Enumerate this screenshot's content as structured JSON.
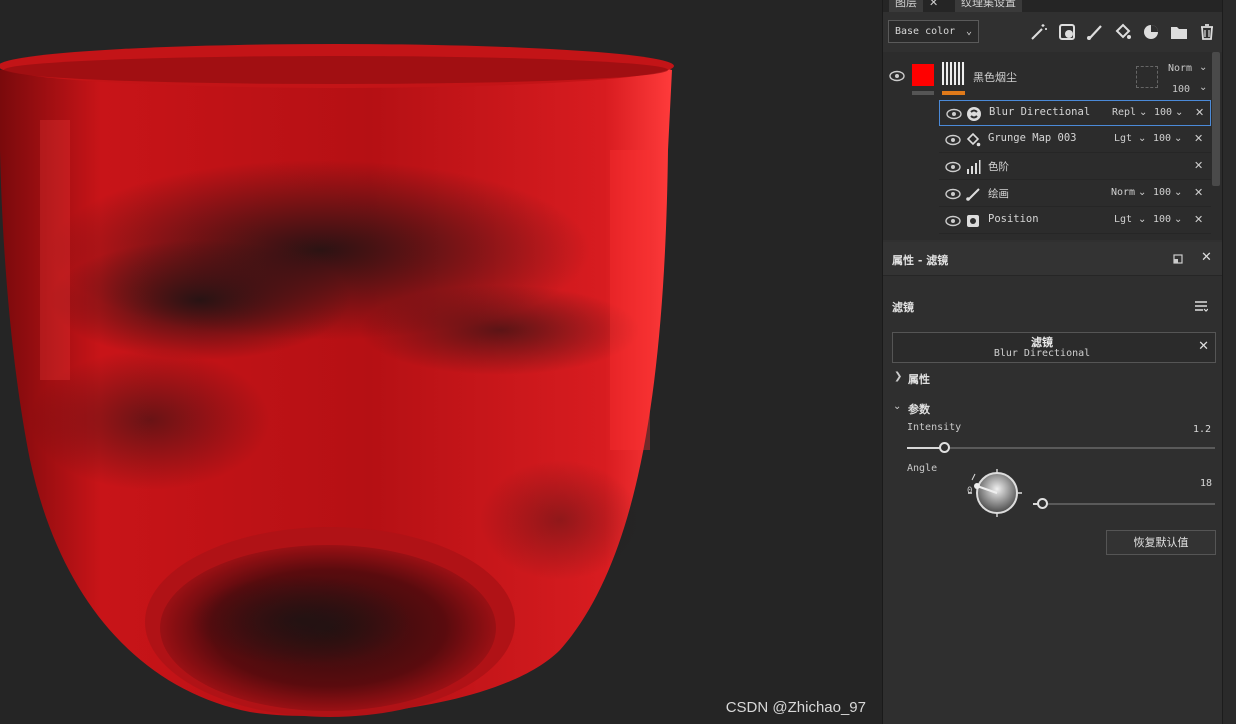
{
  "viewport": {
    "watermark": "CSDN @Zhichao_97"
  },
  "panel": {
    "tabs": [
      {
        "label": "图层"
      },
      {
        "label": "纹理集设置"
      }
    ],
    "channel_select": {
      "value": "Base color"
    },
    "layers": {
      "main": {
        "name": "黑色烟尘",
        "blend": "Norm",
        "opacity": "100",
        "color": "#ff0000"
      },
      "effects": [
        {
          "name": "Blur Directional",
          "blend": "Repl",
          "opacity": "100",
          "icon": "substance-filter-icon"
        },
        {
          "name": "Grunge Map 003",
          "blend": "Lgt",
          "opacity": "100",
          "icon": "fill-bucket-icon"
        },
        {
          "name": "色阶",
          "blend": "",
          "opacity": "",
          "icon": "levels-icon"
        },
        {
          "name": "绘画",
          "blend": "Norm",
          "opacity": "100",
          "icon": "brush-icon"
        },
        {
          "name": "Position",
          "blend": "Lgt",
          "opacity": "100",
          "icon": "generator-icon"
        }
      ]
    },
    "properties": {
      "title": "属性 - 滤镜",
      "filter_section": "滤镜",
      "filter_name": "滤镜",
      "filter_value": "Blur Directional",
      "attr_section": "属性",
      "params_section": "参数",
      "intensity": {
        "label": "Intensity",
        "value": "1.2",
        "fraction": 0.12
      },
      "angle": {
        "label": "Angle",
        "value": "18",
        "dial_mark": "0",
        "fraction": 0.05
      },
      "reset_label": "恢复默认值"
    }
  }
}
